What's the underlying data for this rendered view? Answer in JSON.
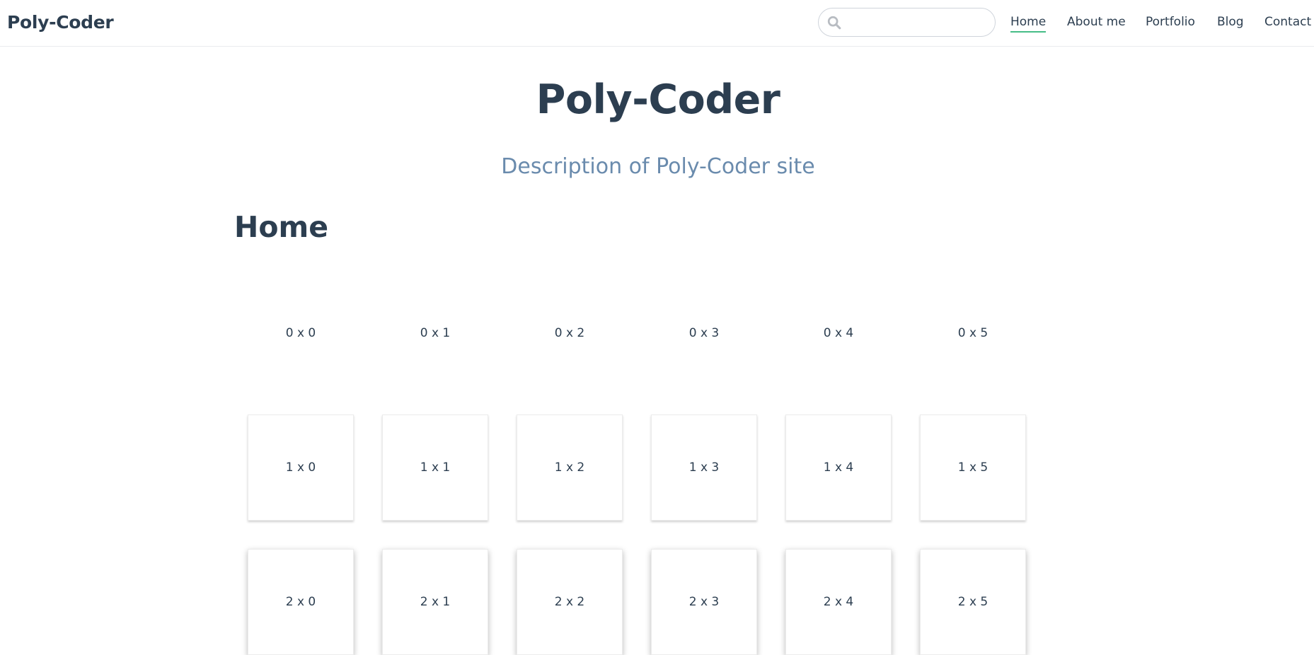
{
  "navbar": {
    "site_name": "Poly-Coder",
    "search": {
      "value": "",
      "placeholder": ""
    },
    "links": [
      {
        "label": "Home",
        "active": true
      },
      {
        "label": "About me",
        "active": false
      },
      {
        "label": "Portfolio",
        "active": false
      },
      {
        "label": "Blog",
        "active": false
      },
      {
        "label": "Contact",
        "active": false
      }
    ]
  },
  "hero": {
    "title": "Poly-Coder",
    "description": "Description of Poly-Coder site"
  },
  "page": {
    "heading": "Home"
  },
  "grid": {
    "rows": [
      [
        "0 x 0",
        "0 x 1",
        "0 x 2",
        "0 x 3",
        "0 x 4",
        "0 x 5"
      ],
      [
        "1 x 0",
        "1 x 1",
        "1 x 2",
        "1 x 3",
        "1 x 4",
        "1 x 5"
      ],
      [
        "2 x 0",
        "2 x 1",
        "2 x 2",
        "2 x 3",
        "2 x 4",
        "2 x 5"
      ]
    ]
  },
  "colors": {
    "text": "#2c3e50",
    "accent": "#46bd87",
    "description": "#6a8bad"
  }
}
